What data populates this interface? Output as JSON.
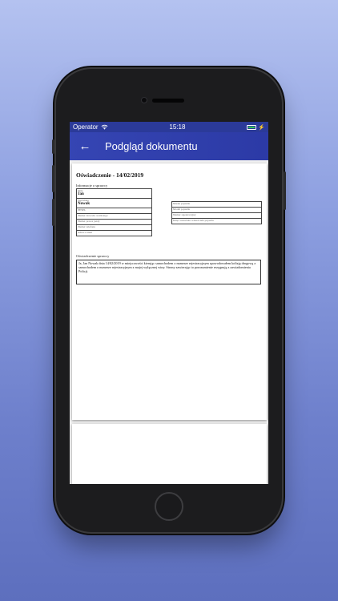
{
  "status": {
    "carrier": "Operator",
    "time": "15:18"
  },
  "appbar": {
    "title": "Podgląd dokumentu"
  },
  "document": {
    "heading": "Oświadczenie - 14/02/2019",
    "info_section": "Informacje o sprawcy",
    "left_fields": [
      {
        "label": "Imię",
        "value": "Jan"
      },
      {
        "label": "Nazwisko",
        "value": "Nowak"
      },
      {
        "label": "PESEL",
        "value": ""
      },
      {
        "label": "Numer dowodu osobistego",
        "value": ""
      },
      {
        "label": "Numer prawa jazdy",
        "value": ""
      },
      {
        "label": "Numer telefonu",
        "value": ""
      },
      {
        "label": "Adres e-mail",
        "value": ""
      }
    ],
    "right_fields": [
      {
        "label": "Marka pojazdu"
      },
      {
        "label": "Model pojazdu"
      },
      {
        "label": "Numer rejestracyjny"
      },
      {
        "label": "Imię i nazwisko właściciela pojazdu"
      }
    ],
    "statement_section": "Oświadczenie sprawcy",
    "statement_text": "Ja, Jan Nowak dnia 14/02/2019 w miejscowości kierując samochodem o numerze rejestracyjnym spowodowałem kolizję drogową z samochodem o numerze rejestracyjnym z mojej wyłącznej winy. Strony zawierając to porozumienie rezygnują z zawiadomienia Policji."
  }
}
